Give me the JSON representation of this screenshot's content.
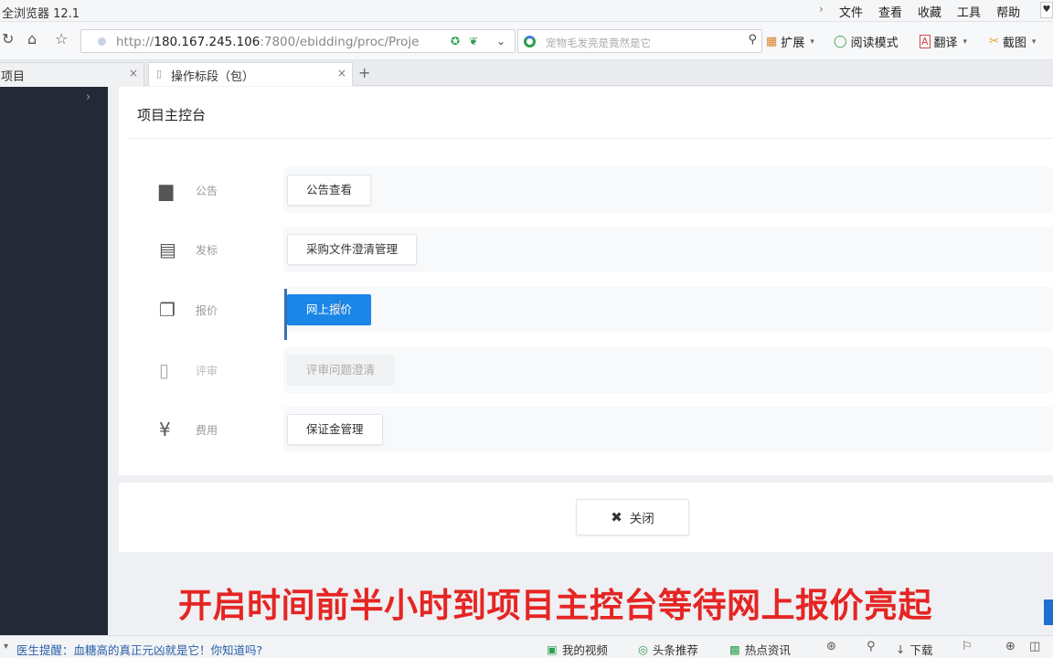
{
  "browser": {
    "title": "全浏览器 12.1",
    "menu": [
      "文件",
      "查看",
      "收藏",
      "工具",
      "帮助"
    ],
    "url_prefix": "http://",
    "url_host": "180.167.245.106",
    "url_rest": ":7800/ebidding/proc/Proje",
    "search_placeholder": "宠物毛发亮是竟然是它",
    "extensions_label": "扩展",
    "reading_mode_label": "阅读模式",
    "translate_label": "翻译",
    "screenshot_label": "截图"
  },
  "tabs": [
    {
      "label": "项目"
    },
    {
      "label": "操作标段（包）"
    }
  ],
  "console": {
    "title": "项目主控台",
    "rows": [
      {
        "icon": "document-icon",
        "label": "公告",
        "button": "公告查看",
        "state": "normal"
      },
      {
        "icon": "bid-document-icon",
        "label": "发标",
        "button": "采购文件澄清管理",
        "state": "normal"
      },
      {
        "icon": "copy-icon",
        "label": "报价",
        "button": "网上报价",
        "state": "primary"
      },
      {
        "icon": "tablet-icon",
        "label": "评审",
        "button": "评审问题澄清",
        "state": "disabled"
      },
      {
        "icon": "yen-icon",
        "label": "费用",
        "button": "保证金管理",
        "state": "normal"
      }
    ],
    "close_label": "关闭"
  },
  "caption": "开启时间前半小时到项目主控台等待网上报价亮起",
  "statusbar": {
    "news": "医生提醒：血糖高的真正元凶就是它！你知道吗?",
    "items": [
      "我的视频",
      "头条推荐",
      "热点资讯"
    ],
    "download": "下载"
  },
  "colors": {
    "sidebar": "#232a35",
    "primary_button": "#1a86e8",
    "caption": "#e52523",
    "selection_bar": "#3b6fb3"
  }
}
